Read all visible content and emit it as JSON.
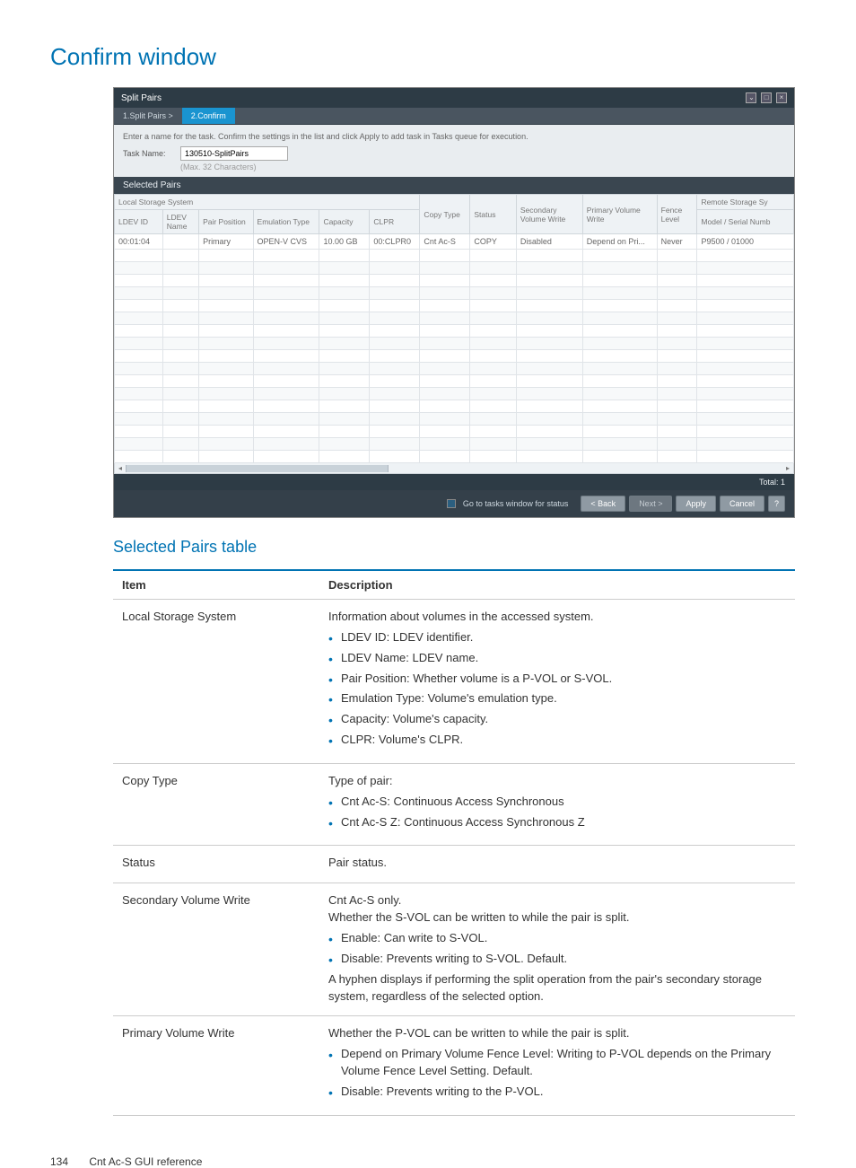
{
  "page": {
    "title": "Confirm window",
    "subtitle": "Selected Pairs table",
    "footer_page": "134",
    "footer_text": "Cnt Ac-S GUI reference"
  },
  "dialog": {
    "title": "Split Pairs",
    "tabs": {
      "t1": "1.Split Pairs  >",
      "t2": "2.Confirm"
    },
    "hint": "Enter a name for the task. Confirm the settings in the list and click Apply to add task in Tasks queue for execution.",
    "task_label": "Task Name:",
    "task_value": "130510-SplitPairs",
    "task_sub": "(Max. 32 Characters)",
    "pane": "Selected Pairs",
    "grouphdr": "Local Storage System",
    "cols": {
      "c0": "LDEV ID",
      "c1": "LDEV\nName",
      "c2": "Pair Position",
      "c3": "Emulation Type",
      "c4": "Capacity",
      "c5": "CLPR",
      "c6": "Copy Type",
      "c7": "Status",
      "c8": "Secondary\nVolume Write",
      "c9": "Primary Volume\nWrite",
      "c10": "Fence\nLevel",
      "c11a": "Remote Storage Sy",
      "c11b": "Model / Serial Numb"
    },
    "row": {
      "r0": "00:01:04",
      "r1": "",
      "r2": "Primary",
      "r3": "OPEN-V CVS",
      "r4": "10.00 GB",
      "r5": "00:CLPR0",
      "r6": "Cnt Ac-S",
      "r7": "COPY",
      "r8": "Disabled",
      "r9": "Depend on Pri...",
      "r10": "Never",
      "r11": "P9500 / 01000"
    },
    "total": "Total: 1",
    "foot_check": "Go to tasks window for status",
    "btn_back": "< Back",
    "btn_next": "Next >",
    "btn_apply": "Apply",
    "btn_cancel": "Cancel",
    "btn_help": "?"
  },
  "desc": {
    "h_item": "Item",
    "h_desc": "Description",
    "rows": [
      {
        "k": "Local Storage System",
        "lead": "Information about volumes in the accessed system.",
        "items": [
          "LDEV ID: LDEV identifier.",
          "LDEV Name: LDEV name.",
          "Pair Position: Whether volume is a P-VOL or S-VOL.",
          "Emulation Type: Volume's emulation type.",
          "Capacity: Volume's capacity.",
          "CLPR: Volume's CLPR."
        ]
      },
      {
        "k": "Copy Type",
        "lead": "Type of pair:",
        "items": [
          "Cnt Ac-S: Continuous Access Synchronous",
          "Cnt Ac-S Z: Continuous Access Synchronous Z"
        ]
      },
      {
        "k": "Status",
        "lead": "Pair status.",
        "items": []
      },
      {
        "k": "Secondary Volume Write",
        "lead": "Cnt Ac-S only.",
        "lead2": "Whether the S-VOL can be written to while the pair is split.",
        "items": [
          "Enable: Can write to S-VOL.",
          "Disable: Prevents writing to S-VOL. Default."
        ],
        "trail": "A hyphen displays if performing the split operation from the pair's secondary storage system, regardless of the selected option."
      },
      {
        "k": "Primary Volume Write",
        "lead": "Whether the P-VOL can be written to while the pair is split.",
        "items": [
          "Depend on Primary Volume Fence Level: Writing to P-VOL depends on the Primary Volume Fence Level Setting. Default.",
          "Disable: Prevents writing to the P-VOL."
        ]
      }
    ]
  }
}
